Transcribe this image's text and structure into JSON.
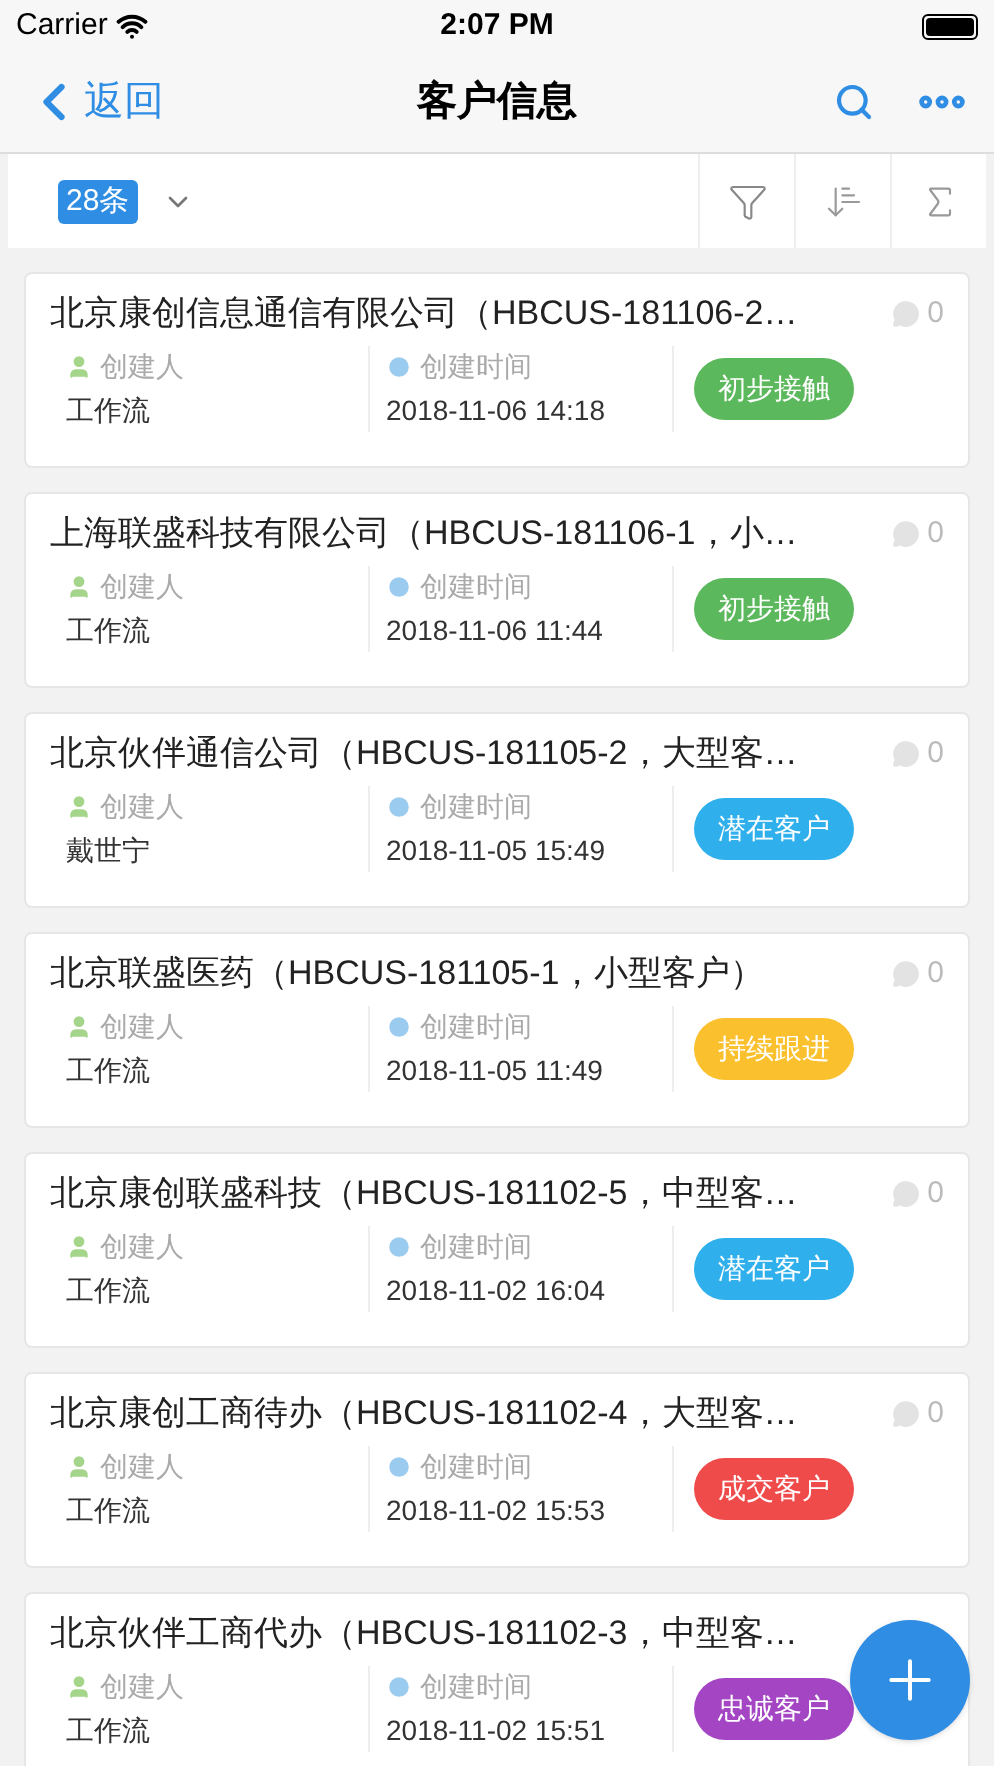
{
  "status_bar": {
    "carrier": "Carrier",
    "time": "2:07 PM"
  },
  "nav": {
    "back": "返回",
    "title": "客户信息"
  },
  "toolbar": {
    "count": "28条"
  },
  "cards": [
    {
      "title": "北京康创信息通信有限公司（HBCUS-181106-2…",
      "comments": "0",
      "creator_label": "创建人",
      "time_label": "创建时间",
      "creator": "工作流",
      "time": "2018-11-06 14:18",
      "tag": "初步接触",
      "color": "#5cb85c"
    },
    {
      "title": "上海联盛科技有限公司（HBCUS-181106-1，小…",
      "comments": "0",
      "creator_label": "创建人",
      "time_label": "创建时间",
      "creator": "工作流",
      "time": "2018-11-06 11:44",
      "tag": "初步接触",
      "color": "#5cb85c"
    },
    {
      "title": "北京伙伴通信公司（HBCUS-181105-2，大型客…",
      "comments": "0",
      "creator_label": "创建人",
      "time_label": "创建时间",
      "creator": "戴世宁",
      "time": "2018-11-05 15:49",
      "tag": "潜在客户",
      "color": "#2fb0ec"
    },
    {
      "title": "北京联盛医药（HBCUS-181105-1，小型客户）",
      "comments": "0",
      "creator_label": "创建人",
      "time_label": "创建时间",
      "creator": "工作流",
      "time": "2018-11-05 11:49",
      "tag": "持续跟进",
      "color": "#fbc02d"
    },
    {
      "title": "北京康创联盛科技（HBCUS-181102-5，中型客…",
      "comments": "0",
      "creator_label": "创建人",
      "time_label": "创建时间",
      "creator": "工作流",
      "time": "2018-11-02 16:04",
      "tag": "潜在客户",
      "color": "#2fb0ec"
    },
    {
      "title": "北京康创工商待办（HBCUS-181102-4，大型客…",
      "comments": "0",
      "creator_label": "创建人",
      "time_label": "创建时间",
      "creator": "工作流",
      "time": "2018-11-02 15:53",
      "tag": "成交客户",
      "color": "#ef4b4b"
    },
    {
      "title": "北京伙伴工商代办（HBCUS-181102-3，中型客…",
      "creator_label": "创建人",
      "time_label": "创建时间",
      "creator": "工作流",
      "time": "2018-11-02 15:51",
      "tag": "忠诚客户",
      "color": "#a445c4"
    }
  ]
}
